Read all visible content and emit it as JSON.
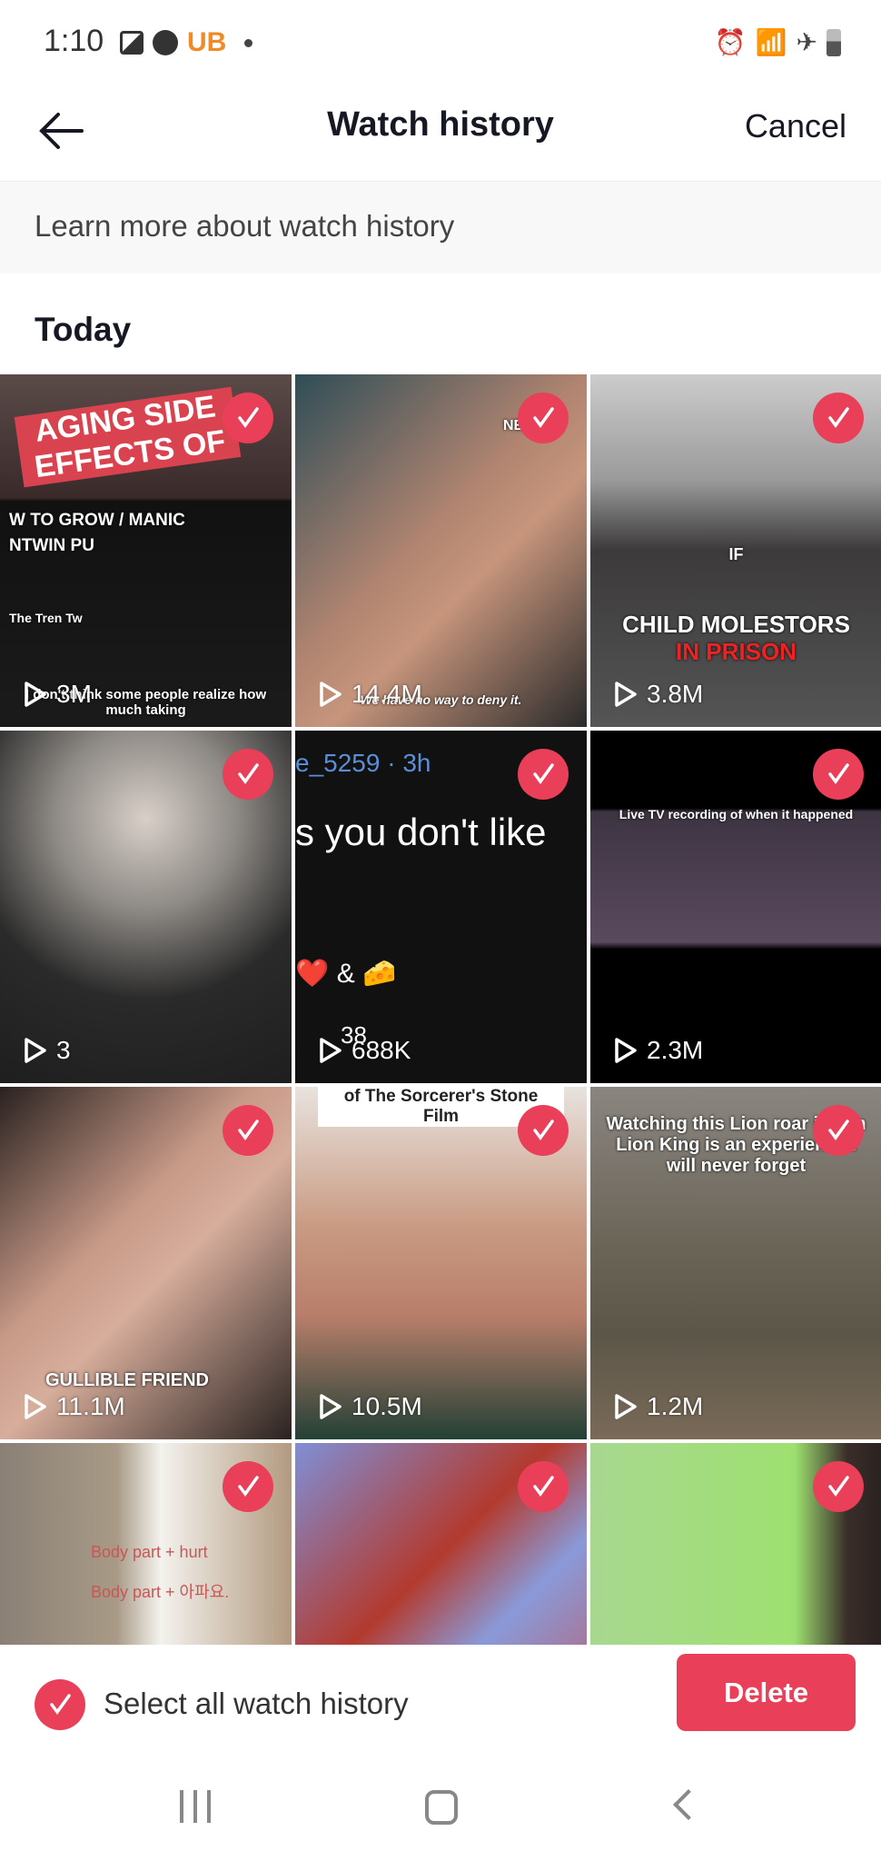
{
  "status_bar": {
    "time": "1:10",
    "left_icons": [
      "gallery-icon",
      "messenger-icon",
      "ub-app-icon",
      "dot-icon"
    ],
    "right_icons": [
      "alarm-icon",
      "wifi-icon",
      "airplane-icon",
      "battery-icon"
    ]
  },
  "header": {
    "title": "Watch history",
    "cancel_label": "Cancel"
  },
  "banner": {
    "text": "Learn more about watch history"
  },
  "section": {
    "title": "Today"
  },
  "colors": {
    "accent": "#ea3f58"
  },
  "videos": [
    {
      "views": "3M",
      "captions": [
        "AGING SIDE EFFECTS OF",
        "W TO GROW    / MANIC",
        "NTWIN PU",
        "The Tren Tw",
        "I don't think some people realize how much taking"
      ],
      "selected": true,
      "bg": "linear-gradient(#5a4a48 0%,#3a2a2a 35%,#111 36%,#1b1b1b 100%)"
    },
    {
      "views": "14.4M",
      "captions": [
        "NET",
        "We have no way to deny it."
      ],
      "selected": true,
      "bg": "linear-gradient(135deg,#2f4d57,#b08470 45%,#c7957c 60%,#2a2a2a)"
    },
    {
      "views": "3.8M",
      "captions": [
        "IF",
        "CHILD MOLESTORS",
        "IN PRISON"
      ],
      "selected": true,
      "bg": "linear-gradient(#ccc 0%,#9a9a9a 30%,#3c3a3a 50%,#555 100%)"
    },
    {
      "views": "3",
      "captions": [],
      "selected": true,
      "bg": "radial-gradient(circle at 50% 25%,#d8cfc8 0%,#8e8a85 30%,#2a2a2a 60%,#1e1e1e 100%)"
    },
    {
      "views": "688K",
      "captions": [
        "e_5259 · 3h",
        "s you don't like",
        "❤️ & 🧀",
        "38"
      ],
      "selected": true,
      "bg": "#111"
    },
    {
      "views": "2.3M",
      "captions": [
        "Live TV recording of when it happened"
      ],
      "selected": true,
      "bg": "linear-gradient(#000 0%,#000 22%,#3d3442 23%,#5a4a5e 60%,#000 62%,#000 100%)"
    },
    {
      "views": "11.1M",
      "captions": [
        "GULLIBLE FRIEND"
      ],
      "selected": true,
      "bg": "linear-gradient(135deg,#2a2220,#c89a88 40%,#d7ad9b 55%,#2a2220)"
    },
    {
      "views": "10.5M",
      "captions": [
        "of The Sorcerer's Stone Film"
      ],
      "selected": true,
      "bg": "linear-gradient(#e8e3de 0%,#c99a82 40%,#b87e6a 65%,#234035 100%)"
    },
    {
      "views": "1.2M",
      "captions": [
        "Watching this Lion roar it is in Lion King is an experience I will never forget"
      ],
      "selected": true,
      "bg": "linear-gradient(#8a8580 0%,#6b6558 45%,#5b5648 70%,#7a6a58 100%)"
    },
    {
      "views": "",
      "captions": [
        "Body part + hurt",
        "Body part + 아파요."
      ],
      "selected": true,
      "bg": "linear-gradient(90deg,#8a8076 0%,#a89a86 40%,#f4f2ee 55%,#b29a80 100%)"
    },
    {
      "views": "",
      "captions": [],
      "selected": true,
      "bg": "linear-gradient(135deg,#7f8fd6,#b33a2e 40%,#8a9ad9 60%,#c94a48 100%)"
    },
    {
      "views": "",
      "captions": [],
      "selected": true,
      "bg": "linear-gradient(90deg,#a8d890 0%,#9ee070 70%,#3a2e2a 88%,#2a2220 100%)"
    }
  ],
  "footer": {
    "select_all_label": "Select all watch history",
    "select_all_checked": true,
    "delete_label": "Delete"
  },
  "nav_bar": {
    "icons": [
      "recent-apps-icon",
      "home-icon",
      "back-icon"
    ]
  }
}
